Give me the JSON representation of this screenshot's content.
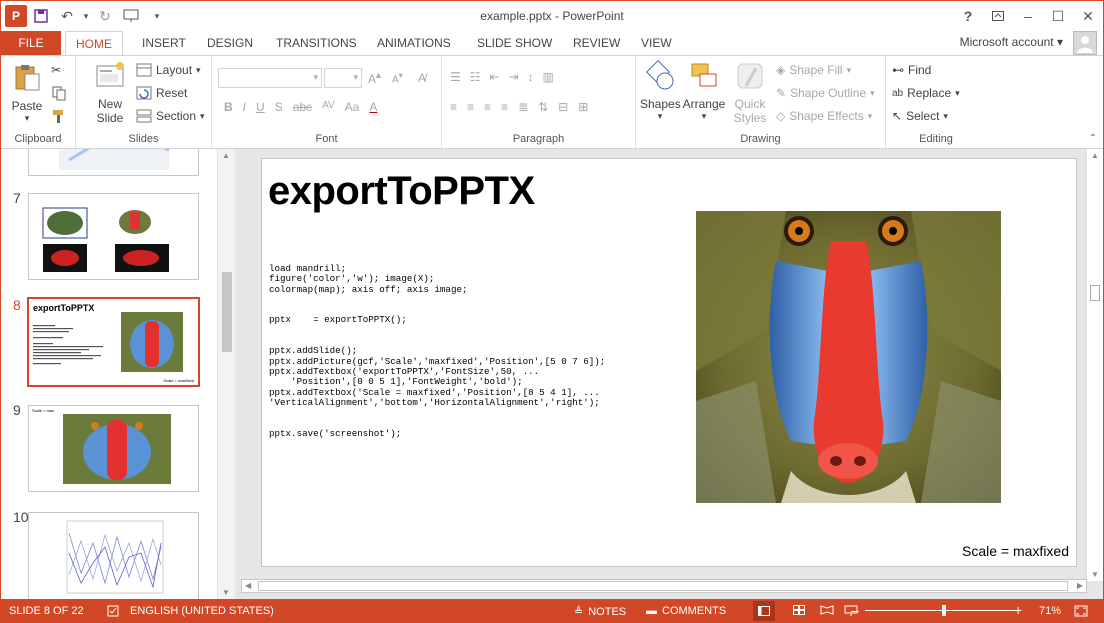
{
  "window": {
    "title": "example.pptx - PowerPoint",
    "app_logo": "P",
    "help": "?",
    "ribbon_display": "ribbon-display-icon",
    "minimize": "–",
    "maximize": "☐",
    "close": "✕"
  },
  "tabs": [
    "FILE",
    "HOME",
    "INSERT",
    "DESIGN",
    "TRANSITIONS",
    "ANIMATIONS",
    "SLIDE SHOW",
    "REVIEW",
    "VIEW"
  ],
  "account": "Microsoft account",
  "ribbon": {
    "clipboard": {
      "paste": "Paste",
      "label": "Clipboard"
    },
    "slides": {
      "new_slide": "New Slide",
      "layout": "Layout",
      "reset": "Reset",
      "section": "Section",
      "label": "Slides"
    },
    "font": {
      "label": "Font",
      "bold": "B",
      "italic": "I",
      "underline": "U",
      "strike": "S",
      "abc": "abc",
      "av": "AV",
      "aa": "Aa",
      "a_color": "A"
    },
    "paragraph": {
      "label": "Paragraph"
    },
    "drawing": {
      "shapes": "Shapes",
      "arrange": "Arrange",
      "quick_styles": "Quick Styles",
      "shape_fill": "Shape Fill",
      "shape_outline": "Shape Outline",
      "shape_effects": "Shape Effects",
      "label": "Drawing"
    },
    "editing": {
      "find": "Find",
      "replace": "Replace",
      "select": "Select",
      "label": "Editing"
    }
  },
  "thumbnails": [
    {
      "num": "7"
    },
    {
      "num": "8",
      "title": "exportToPPTX",
      "caption": "Scale = maxfixed"
    },
    {
      "num": "9",
      "caption": "Scale = max"
    },
    {
      "num": "10"
    }
  ],
  "slide": {
    "title": "exportToPPTX",
    "code": "load mandrill;\nfigure('color','w'); image(X);\ncolormap(map); axis off; axis image;\n\n\npptx    = exportToPPTX();\n\n\npptx.addSlide();\npptx.addPicture(gcf,'Scale','maxfixed','Position',[5 0 7 6]);\npptx.addTextbox('exportToPPTX','FontSize',50, ...\n    'Position',[0 0 5 1],'FontWeight','bold');\npptx.addTextbox('Scale = maxfixed','Position',[8 5 4 1], ...\n'VerticalAlignment','bottom','HorizontalAlignment','right');\n\n\npptx.save('screenshot');",
    "image_alt": "mandrill",
    "scale_label": "Scale = maxfixed"
  },
  "status": {
    "slide_of": "SLIDE 8 OF 22",
    "language": "ENGLISH (UNITED STATES)",
    "notes": "NOTES",
    "comments": "COMMENTS",
    "zoom_minus": "–",
    "zoom_plus": "+",
    "zoom": "71%",
    "zoom_level_percent": 71
  },
  "colors": {
    "accent": "#d24726",
    "ribbon_bg": "#ffffff",
    "editor_bg": "#e6e6e6"
  }
}
